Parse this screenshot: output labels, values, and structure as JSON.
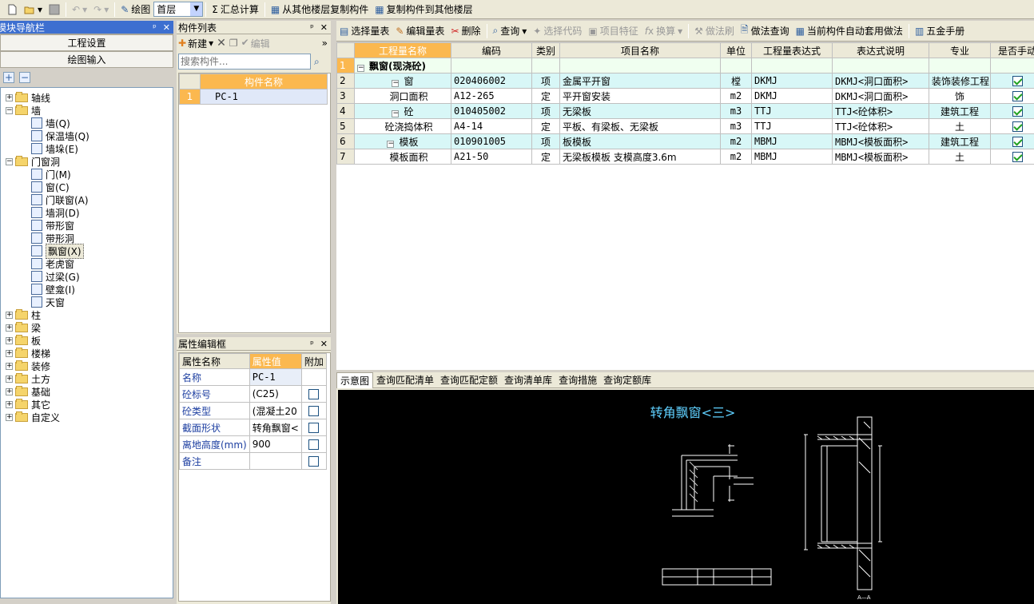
{
  "toolbar": {
    "draw_label": "绘图",
    "floor_value": "首层",
    "sum_label": "汇总计算",
    "copy_from_label": "从其他楼层复制构件",
    "copy_to_label": "复制构件到其他楼层"
  },
  "nav": {
    "title": "模块导航栏",
    "project_settings": "工程设置",
    "draw_input": "绘图输入",
    "tree": [
      {
        "label": "轴线",
        "level": 0,
        "type": "folder",
        "expanded": false
      },
      {
        "label": "墙",
        "level": 0,
        "type": "folder",
        "expanded": true
      },
      {
        "label": "墙(Q)",
        "level": 1,
        "type": "leaf"
      },
      {
        "label": "保温墙(Q)",
        "level": 1,
        "type": "leaf"
      },
      {
        "label": "墙垛(E)",
        "level": 1,
        "type": "leaf"
      },
      {
        "label": "门窗洞",
        "level": 0,
        "type": "folder",
        "expanded": true
      },
      {
        "label": "门(M)",
        "level": 1,
        "type": "leaf"
      },
      {
        "label": "窗(C)",
        "level": 1,
        "type": "leaf"
      },
      {
        "label": "门联窗(A)",
        "level": 1,
        "type": "leaf"
      },
      {
        "label": "墙洞(D)",
        "level": 1,
        "type": "leaf"
      },
      {
        "label": "带形窗",
        "level": 1,
        "type": "leaf"
      },
      {
        "label": "带形洞",
        "level": 1,
        "type": "leaf"
      },
      {
        "label": "飘窗(X)",
        "level": 1,
        "type": "leaf",
        "selected": true
      },
      {
        "label": "老虎窗",
        "level": 1,
        "type": "leaf"
      },
      {
        "label": "过梁(G)",
        "level": 1,
        "type": "leaf"
      },
      {
        "label": "壁龛(I)",
        "level": 1,
        "type": "leaf"
      },
      {
        "label": "天窗",
        "level": 1,
        "type": "leaf"
      },
      {
        "label": "柱",
        "level": 0,
        "type": "folder",
        "expanded": false
      },
      {
        "label": "梁",
        "level": 0,
        "type": "folder",
        "expanded": false
      },
      {
        "label": "板",
        "level": 0,
        "type": "folder",
        "expanded": false
      },
      {
        "label": "楼梯",
        "level": 0,
        "type": "folder",
        "expanded": false
      },
      {
        "label": "装修",
        "level": 0,
        "type": "folder",
        "expanded": false
      },
      {
        "label": "土方",
        "level": 0,
        "type": "folder",
        "expanded": false
      },
      {
        "label": "基础",
        "level": 0,
        "type": "folder",
        "expanded": false
      },
      {
        "label": "其它",
        "level": 0,
        "type": "folder",
        "expanded": false
      },
      {
        "label": "自定义",
        "level": 0,
        "type": "folder",
        "expanded": false
      }
    ]
  },
  "components": {
    "title": "构件列表",
    "new_label": "新建",
    "edit_label": "编辑",
    "search_placeholder": "搜索构件...",
    "col_name": "构件名称",
    "rows": [
      {
        "idx": "1",
        "name": "PC-1"
      }
    ]
  },
  "props": {
    "title": "属性编辑框",
    "col_name": "属性名称",
    "col_value": "属性值",
    "col_extra": "附加",
    "rows": [
      {
        "name": "名称",
        "value": "PC-1",
        "has_cb": false
      },
      {
        "name": "砼标号",
        "value": "(C25)",
        "has_cb": true
      },
      {
        "name": "砼类型",
        "value": "(混凝土20",
        "has_cb": true
      },
      {
        "name": "截面形状",
        "value": "转角飘窗<",
        "has_cb": true
      },
      {
        "name": "离地高度(mm)",
        "value": "900",
        "has_cb": true
      },
      {
        "name": "备注",
        "value": "",
        "has_cb": true
      }
    ]
  },
  "qty_toolbar": {
    "select_table": "选择量表",
    "edit_table": "编辑量表",
    "delete": "删除",
    "query": "查询",
    "select_code": "选择代码",
    "item_feature": "项目特征",
    "convert": "换算",
    "brush": "做法刷",
    "method_query": "做法查询",
    "auto_apply": "当前构件自动套用做法",
    "hardware_manual": "五金手册"
  },
  "qty_table": {
    "headers": [
      "工程量名称",
      "编码",
      "类别",
      "项目名称",
      "单位",
      "工程量表达式",
      "表达式说明",
      "专业",
      "是否手动"
    ],
    "rows": [
      {
        "idx": "1",
        "name": "飘窗(现浇砼)",
        "code": "",
        "cat": "",
        "item": "",
        "unit": "",
        "expr": "",
        "desc": "",
        "major": "",
        "manual": false,
        "group": true
      },
      {
        "idx": "2",
        "name": "窗",
        "code": "020406002",
        "cat": "项",
        "item": "金属平开窗",
        "unit": "樘",
        "expr": "DKMJ",
        "desc": "DKMJ<洞口面积>",
        "major": "装饰装修工程",
        "manual": true,
        "hl": true
      },
      {
        "idx": "3",
        "name": "洞口面积",
        "code": "A12-265",
        "cat": "定",
        "item": "平开窗安装",
        "unit": "m2",
        "expr": "DKMJ",
        "desc": "DKMJ<洞口面积>",
        "major": "饰",
        "manual": true
      },
      {
        "idx": "4",
        "name": "砼",
        "code": "010405002",
        "cat": "项",
        "item": "无梁板",
        "unit": "m3",
        "expr": "TTJ",
        "desc": "TTJ<砼体积>",
        "major": "建筑工程",
        "manual": true,
        "hl": true
      },
      {
        "idx": "5",
        "name": "砼浇捣体积",
        "code": "A4-14",
        "cat": "定",
        "item": "平板、有梁板、无梁板",
        "unit": "m3",
        "expr": "TTJ",
        "desc": "TTJ<砼体积>",
        "major": "土",
        "manual": true
      },
      {
        "idx": "6",
        "name": "模板",
        "code": "010901005",
        "cat": "项",
        "item": "板模板",
        "unit": "m2",
        "expr": "MBMJ",
        "desc": "MBMJ<模板面积>",
        "major": "建筑工程",
        "manual": true,
        "hl": true
      },
      {
        "idx": "7",
        "name": "模板面积",
        "code": "A21-50",
        "cat": "定",
        "item": "无梁板模板 支模高度3.6m",
        "unit": "m2",
        "expr": "MBMJ",
        "desc": "MBMJ<模板面积>",
        "major": "土",
        "manual": true
      }
    ]
  },
  "bottom_tabs": [
    "示意图",
    "查询匹配清单",
    "查询匹配定额",
    "查询清单库",
    "查询措施",
    "查询定额库"
  ],
  "diagram": {
    "title": "转角飘窗<三>",
    "section_label": "A—A"
  },
  "colors": {
    "accent": "#fbb84f",
    "row_highlight": "#d8f7f7",
    "cad_bg": "#000000",
    "cad_line": "#ffffff",
    "cad_text": "#5fd0ff"
  }
}
